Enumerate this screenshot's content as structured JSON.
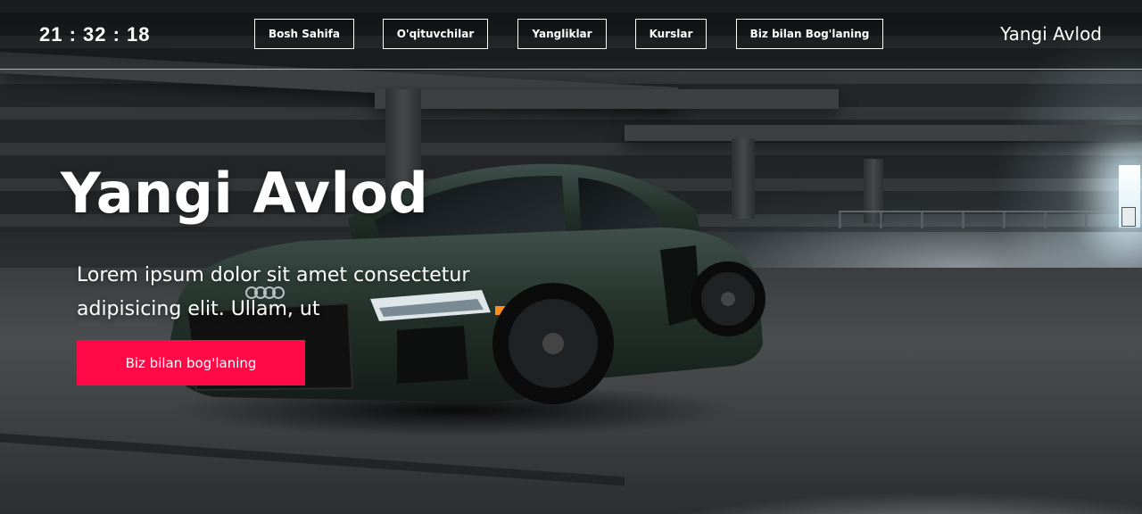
{
  "header": {
    "clock": "21 : 32 : 18",
    "nav": [
      {
        "label": "Bosh Sahifa"
      },
      {
        "label": "O'qituvchilar"
      },
      {
        "label": "Yangliklar"
      },
      {
        "label": "Kurslar"
      },
      {
        "label": "Biz bilan Bog'laning"
      }
    ],
    "brand": "Yangi Avlod"
  },
  "hero": {
    "title": "Yangi Avlod",
    "text": "Lorem ipsum dolor sit amet consectetur adipisicing elit. Ullam, ut",
    "cta_label": "Biz bilan bog'laning"
  },
  "colors": {
    "accent": "#ff0a47",
    "text": "#ffffff"
  }
}
